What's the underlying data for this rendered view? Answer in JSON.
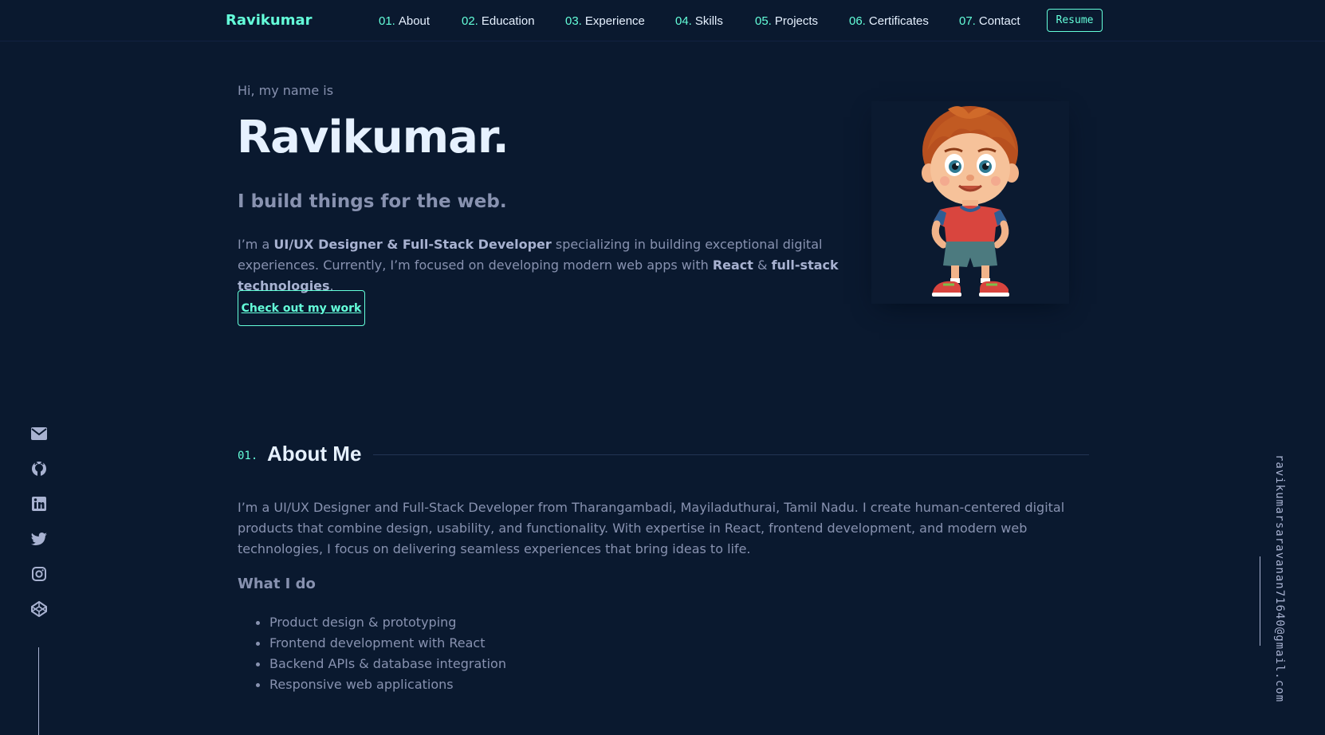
{
  "nav": {
    "logo": "Ravikumar",
    "links": [
      {
        "num": "01.",
        "label": "About"
      },
      {
        "num": "02.",
        "label": "Education"
      },
      {
        "num": "03.",
        "label": "Experience"
      },
      {
        "num": "04.",
        "label": "Skills"
      },
      {
        "num": "05.",
        "label": "Projects"
      },
      {
        "num": "06.",
        "label": "Certificates"
      },
      {
        "num": "07.",
        "label": "Contact"
      }
    ],
    "resume_label": "Resume"
  },
  "hero": {
    "greeting": "Hi, my name is",
    "name": "Ravikumar.",
    "tagline": "I build things for the web.",
    "desc_1": "I’m a ",
    "desc_role": "UI/UX Designer & Full-Stack Developer",
    "desc_2": " specializing in building exceptional digital experiences. Currently, I’m focused on developing modern web apps with ",
    "desc_react": "React",
    "desc_3": " & ",
    "desc_fullstack": "full-stack technologies",
    "desc_4": ".",
    "cta_label": "Check out my work"
  },
  "socials": [
    "mail-icon",
    "github-icon",
    "linkedin-icon",
    "twitter-icon",
    "instagram-icon",
    "codepen-icon"
  ],
  "email": "ravikumarsaravanan71640@gmail.com",
  "about": {
    "number": "01.",
    "title": "About Me",
    "paragraph": "I’m a UI/UX Designer and Full-Stack Developer from Tharangambadi, Mayiladuthurai, Tamil Nadu. I create human-centered digital products that combine design, usability, and functionality. With expertise in React, frontend development, and modern web technologies, I focus on delivering seamless experiences that bring ideas to life.",
    "what_i_do_title": "What I do",
    "what_i_do": [
      "Product design & prototyping",
      "Frontend development with React",
      "Backend APIs & database integration",
      "Responsive web applications"
    ]
  },
  "colors": {
    "background": "#0a192f",
    "accent": "#64ffda",
    "heading": "#e6f1ff",
    "text": "#8892b0"
  }
}
